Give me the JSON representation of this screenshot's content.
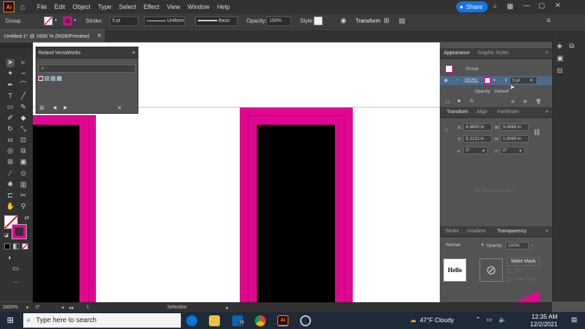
{
  "menubar": {
    "app_logo": "Ai",
    "items": [
      "File",
      "Edit",
      "Object",
      "Type",
      "Select",
      "Effect",
      "View",
      "Window",
      "Help"
    ],
    "share_label": "Share"
  },
  "control": {
    "selection_type": "Group",
    "stroke_label": "Stroke:",
    "stroke_weight": "5 pt",
    "profile_uniform": "Uniform",
    "brush_basic": "Basic",
    "opacity_label": "Opacity:",
    "opacity_value": "100%",
    "style_label": "Style:",
    "transform_label": "Transform"
  },
  "doc": {
    "tab_title": "Untitled-1* @ 1600 % (RGB/Preview)"
  },
  "versaworks": {
    "title": "Roland VersaWorks",
    "search_placeholder": ""
  },
  "appearance": {
    "tab_appearance": "Appearance",
    "tab_graphic_styles": "Graphic Styles",
    "object_type": "Group",
    "stroke_label": "Stroke:",
    "stroke_weight": "5 pt",
    "opacity_label": "Opacity:",
    "opacity_value": "Default"
  },
  "transform": {
    "tab_transform": "Transform",
    "tab_align": "Align",
    "tab_pathfinder": "Pathfinder",
    "x_label": "X:",
    "x_value": "6.8805 in",
    "y_label": "Y:",
    "y_value": "5.2222 in",
    "w_label": "W:",
    "w_value": "9.0868 in",
    "h_label": "H:",
    "h_value": "1.9069 in",
    "rotate_value": "0°",
    "shear_value": "0°",
    "no_shape_text": "No Shape Properties"
  },
  "transparency": {
    "tab_stroke": "Stroke",
    "tab_gradient": "Gradient",
    "tab_transparency": "Transparency",
    "blend_mode": "Normal",
    "opacity_label": "Opacity:",
    "opacity_value": "100%",
    "thumbnail_text": "Hello",
    "make_mask": "Make Mask",
    "clip_label": "Clip",
    "invert_mask_label": "Invert Mask"
  },
  "statusbar": {
    "zoom": "1600%",
    "rotation": "0°",
    "artboard": "1",
    "tool": "Selection"
  },
  "taskbar": {
    "search_placeholder": "Type here to search",
    "weather": "47°F  Cloudy",
    "time": "12:35 AM",
    "date": "12/2/2021",
    "mail_badge": "18"
  },
  "colors": {
    "magenta": "#e0068f",
    "accent_blue": "#1473e6"
  }
}
